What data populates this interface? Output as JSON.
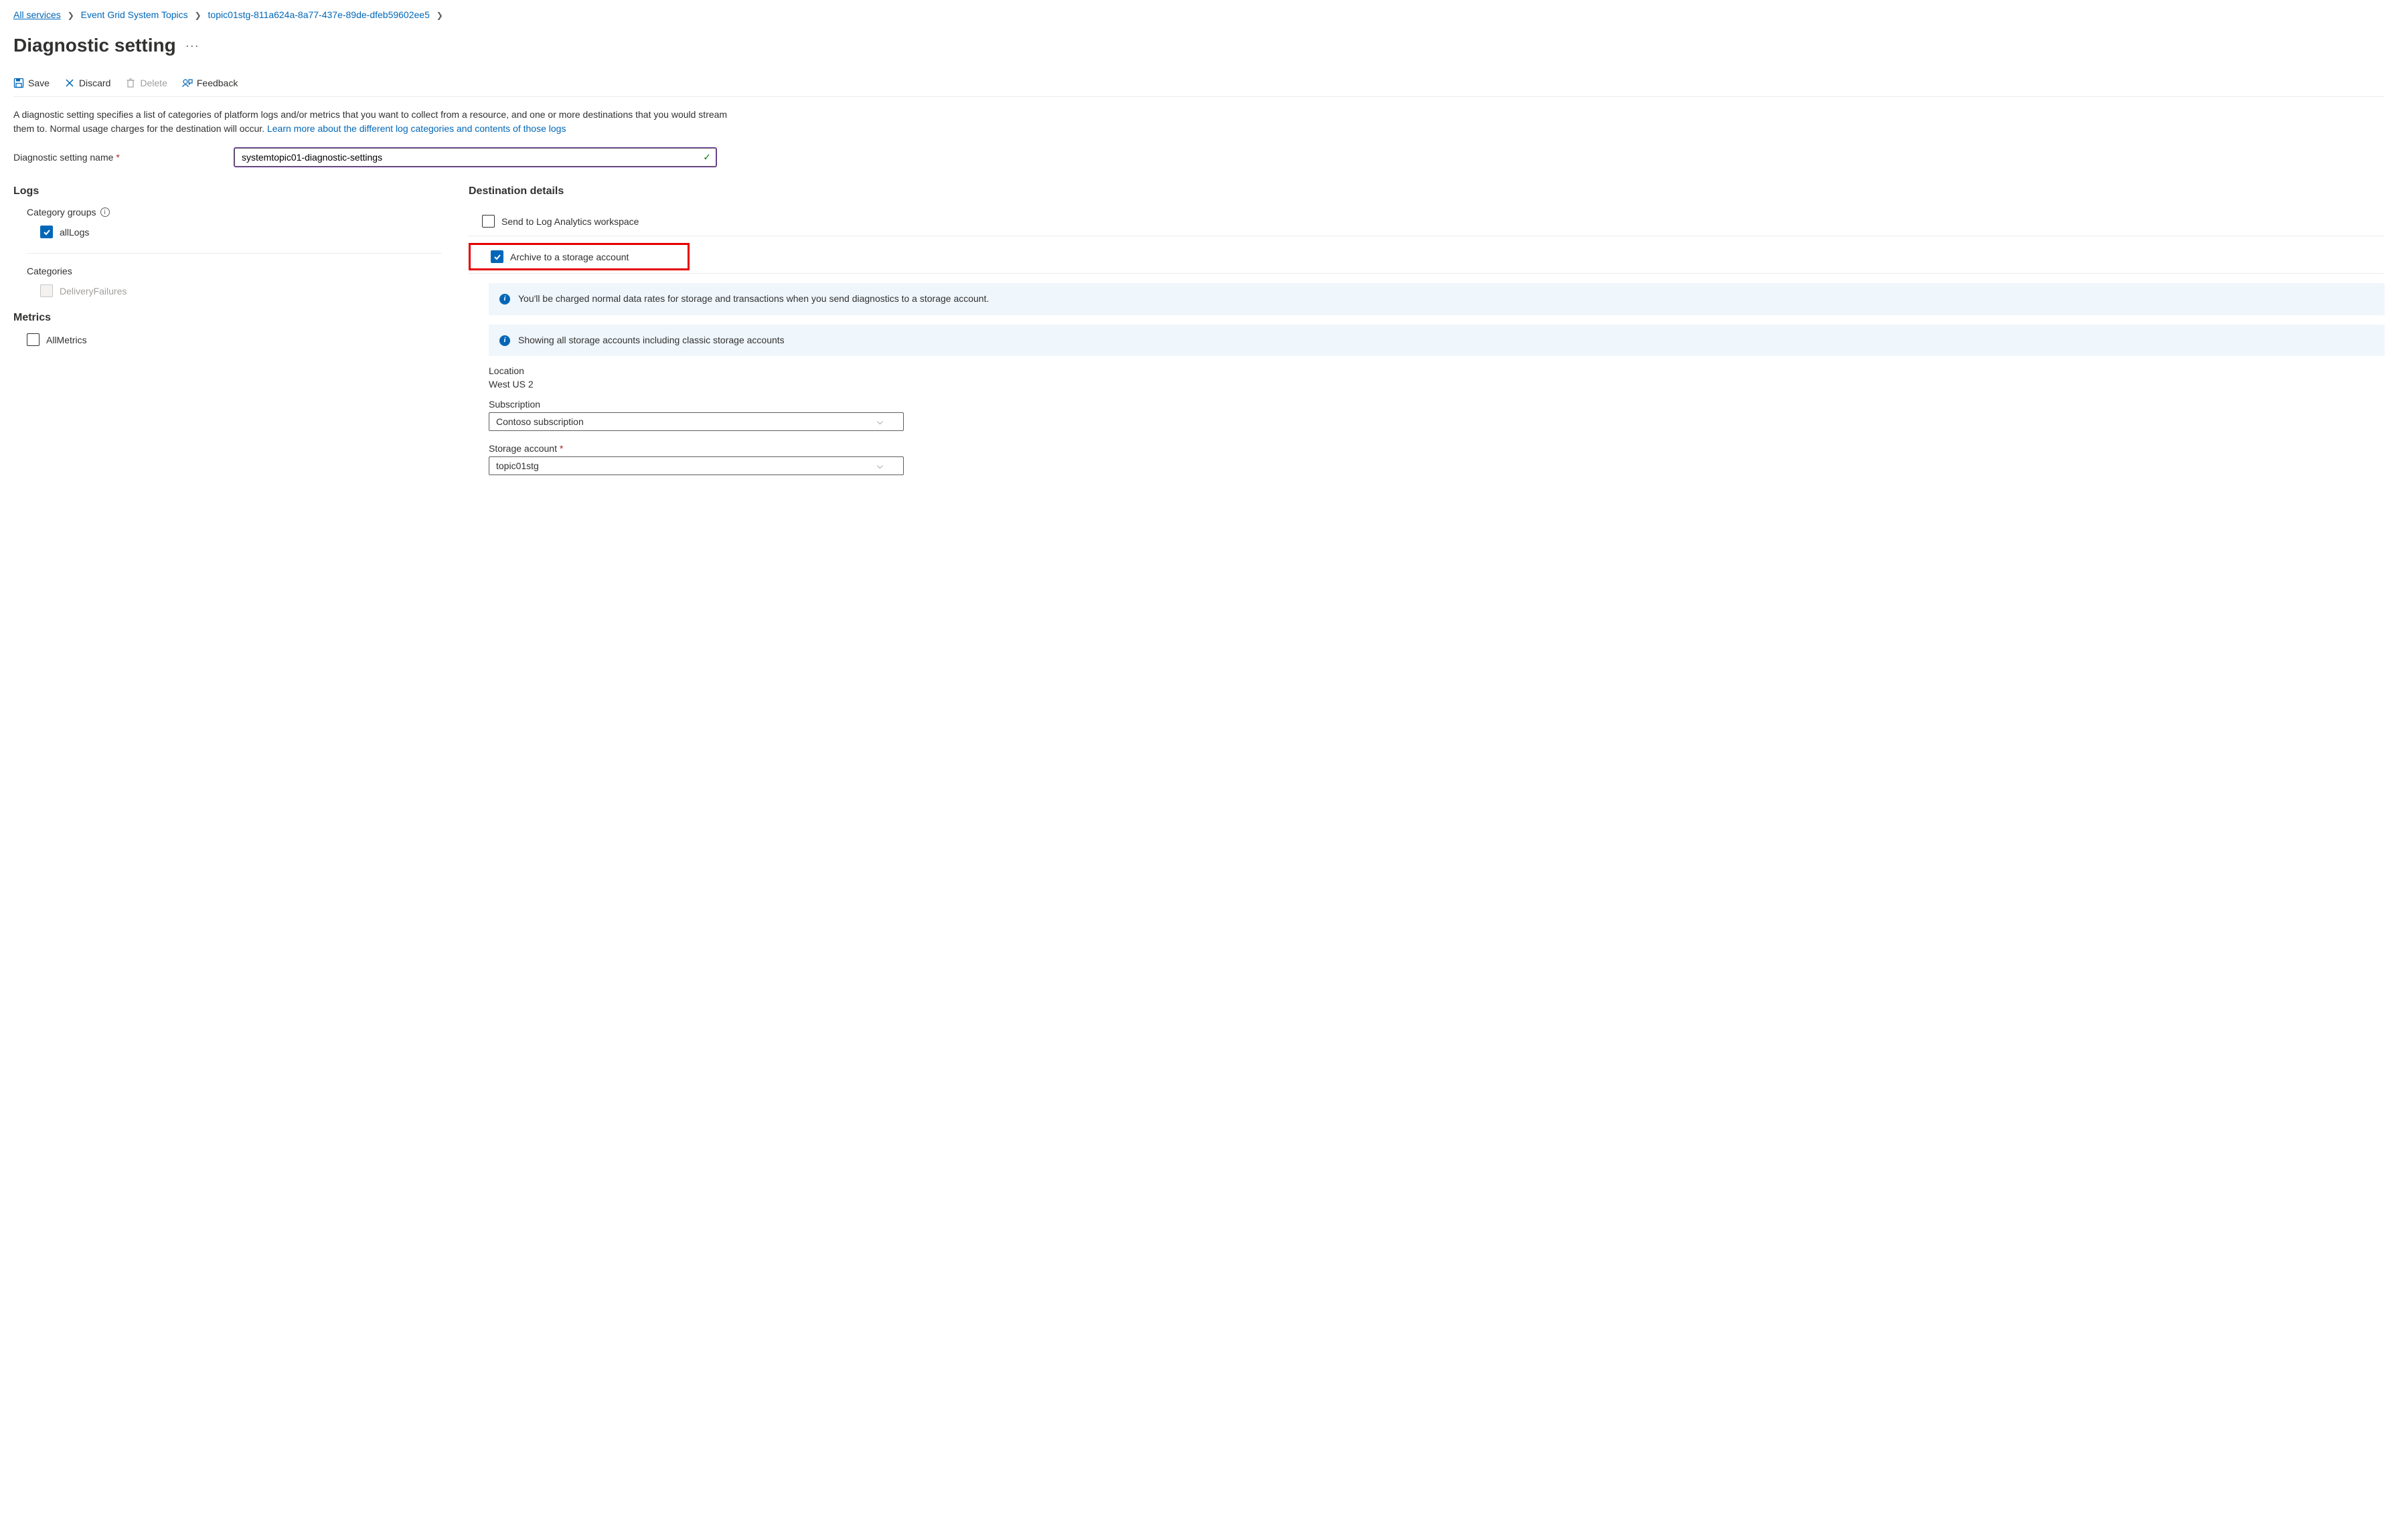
{
  "breadcrumb": {
    "items": [
      {
        "label": "All services"
      },
      {
        "label": "Event Grid System Topics"
      },
      {
        "label": "topic01stg-811a624a-8a77-437e-89de-dfeb59602ee5"
      }
    ]
  },
  "page": {
    "title": "Diagnostic setting",
    "more": "···"
  },
  "toolbar": {
    "save": "Save",
    "discard": "Discard",
    "delete": "Delete",
    "feedback": "Feedback"
  },
  "description": {
    "text": "A diagnostic setting specifies a list of categories of platform logs and/or metrics that you want to collect from a resource, and one or more destinations that you would stream them to. Normal usage charges for the destination will occur. ",
    "link": "Learn more about the different log categories and contents of those logs"
  },
  "nameField": {
    "label": "Diagnostic setting name",
    "value": "systemtopic01-diagnostic-settings"
  },
  "logs": {
    "heading": "Logs",
    "categoryGroupsLabel": "Category groups",
    "allLogs": "allLogs",
    "categoriesLabel": "Categories",
    "deliveryFailures": "DeliveryFailures"
  },
  "metrics": {
    "heading": "Metrics",
    "allMetrics": "AllMetrics"
  },
  "destination": {
    "heading": "Destination details",
    "sendLogAnalytics": "Send to Log Analytics workspace",
    "archiveStorage": "Archive to a storage account",
    "infoCharge": "You'll be charged normal data rates for storage and transactions when you send diagnostics to a storage account.",
    "infoShowing": "Showing all storage accounts including classic storage accounts",
    "locationLabel": "Location",
    "locationValue": "West US 2",
    "subscriptionLabel": "Subscription",
    "subscriptionValue": "Contoso subscription",
    "storageAccountLabel": "Storage account",
    "storageAccountValue": "topic01stg"
  }
}
